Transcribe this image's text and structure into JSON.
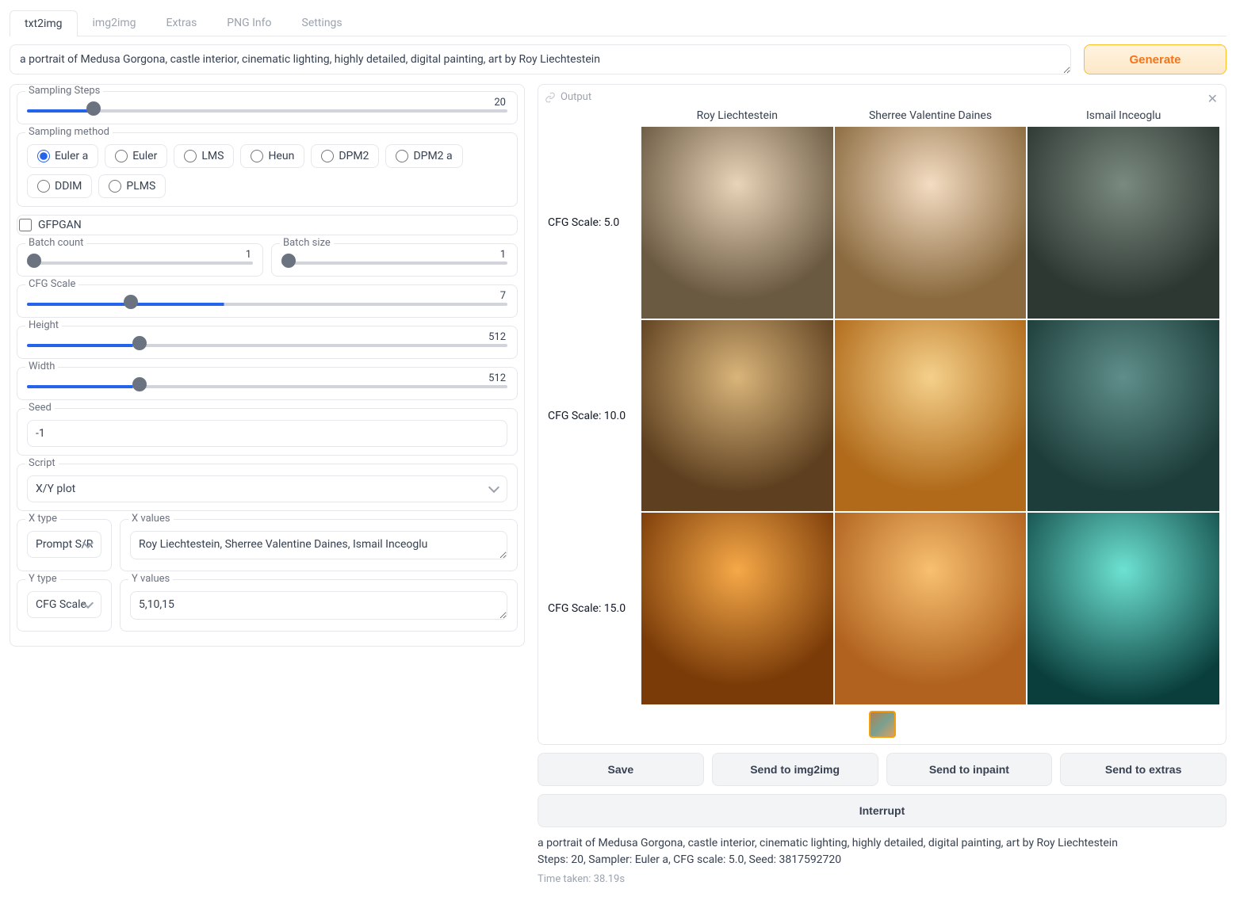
{
  "tabs": [
    "txt2img",
    "img2img",
    "Extras",
    "PNG Info",
    "Settings"
  ],
  "active_tab": "txt2img",
  "prompt": "a portrait of Medusa Gorgona, castle interior, cinematic lighting, highly detailed, digital painting, art by Roy Liechtestein",
  "generate_label": "Generate",
  "sampling_steps": {
    "label": "Sampling Steps",
    "value": 20,
    "min": 1,
    "max": 150,
    "pct": "13%"
  },
  "sampling_method": {
    "label": "Sampling method",
    "options": [
      "Euler a",
      "Euler",
      "LMS",
      "Heun",
      "DPM2",
      "DPM2 a",
      "DDIM",
      "PLMS"
    ],
    "selected": "Euler a"
  },
  "gfpgan": {
    "label": "GFPGAN",
    "checked": false
  },
  "batch_count": {
    "label": "Batch count",
    "value": 1,
    "min": 1,
    "max": 16,
    "pct": "0%"
  },
  "batch_size": {
    "label": "Batch size",
    "value": 1,
    "min": 1,
    "max": 8,
    "pct": "0%"
  },
  "cfg_scale": {
    "label": "CFG Scale",
    "value": 7,
    "min": 1,
    "max": 30,
    "pct": "41%"
  },
  "height": {
    "label": "Height",
    "value": 512,
    "min": 64,
    "max": 2048,
    "pct": "22%"
  },
  "width": {
    "label": "Width",
    "value": 512,
    "min": 64,
    "max": 2048,
    "pct": "22%"
  },
  "seed": {
    "label": "Seed",
    "value": "-1"
  },
  "script": {
    "label": "Script",
    "value": "X/Y plot"
  },
  "x_type": {
    "label": "X type",
    "value": "Prompt S/R"
  },
  "x_values": {
    "label": "X values",
    "value": "Roy Liechtestein, Sherree Valentine Daines, Ismail Inceoglu"
  },
  "y_type": {
    "label": "Y type",
    "value": "CFG Scale"
  },
  "y_values": {
    "label": "Y values",
    "value": "5,10,15"
  },
  "output": {
    "label": "Output",
    "col_headers": [
      "Roy Liechtestein",
      "Sherree Valentine Daines",
      "Ismail Inceoglu"
    ],
    "row_labels": [
      "CFG Scale: 5.0",
      "CFG Scale: 10.0",
      "CFG Scale: 15.0"
    ]
  },
  "buttons": {
    "save": "Save",
    "send_img2img": "Send to img2img",
    "send_inpaint": "Send to inpaint",
    "send_extras": "Send to extras",
    "interrupt": "Interrupt"
  },
  "summary": {
    "line1": "a portrait of Medusa Gorgona, castle interior, cinematic lighting, highly detailed, digital painting, art by Roy Liechtestein",
    "line2": "Steps: 20, Sampler: Euler a, CFG scale: 5.0, Seed: 3817592720",
    "time": "Time taken: 38.19s"
  }
}
